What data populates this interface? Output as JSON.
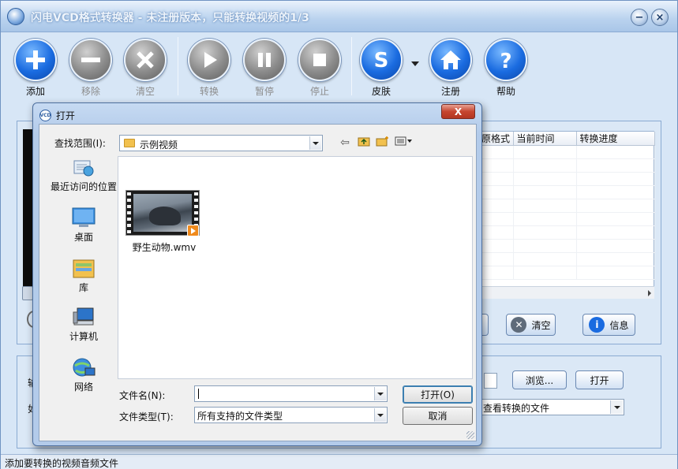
{
  "app": {
    "title": "闪电VCD格式转换器 - 未注册版本，只能转换视频的1/3"
  },
  "toolbar": {
    "add": "添加",
    "remove": "移除",
    "clear": "清空",
    "convert": "转换",
    "pause": "暂停",
    "stop": "停止",
    "skin": "皮肤",
    "register": "注册",
    "help": "帮助"
  },
  "file_table": {
    "columns": [
      "原格式",
      "当前时间",
      "转换进度"
    ]
  },
  "main_buttons": {
    "clear": "清空",
    "info": "信息",
    "browse": "浏览...",
    "open": "打开",
    "after_convert": "查看转换的文件"
  },
  "side_glyphs": [
    "输",
    "如"
  ],
  "statusbar": {
    "text": "添加要转换的视频音频文件"
  },
  "dialog": {
    "icon_text": "VCD",
    "title": "打开",
    "close": "X",
    "look_in_label": "查找范围(I):",
    "look_in_value": "示例视频",
    "places": [
      {
        "label": "最近访问的位置",
        "icon": "recent-places-icon"
      },
      {
        "label": "桌面",
        "icon": "desktop-icon"
      },
      {
        "label": "库",
        "icon": "libraries-icon"
      },
      {
        "label": "计算机",
        "icon": "computer-icon"
      },
      {
        "label": "网络",
        "icon": "network-icon"
      }
    ],
    "files": [
      {
        "name": "野生动物.wmv",
        "icon": "video-thumbnail-icon"
      }
    ],
    "filename_label": "文件名(N):",
    "filename_value": "",
    "filetype_label": "文件类型(T):",
    "filetype_value": "所有支持的文件类型",
    "open_button": "打开(O)",
    "cancel_button": "取消"
  },
  "colors": {
    "accent_blue": "#1a6be0",
    "disabled_gray": "#8b8b8b",
    "close_red": "#c6452f"
  }
}
